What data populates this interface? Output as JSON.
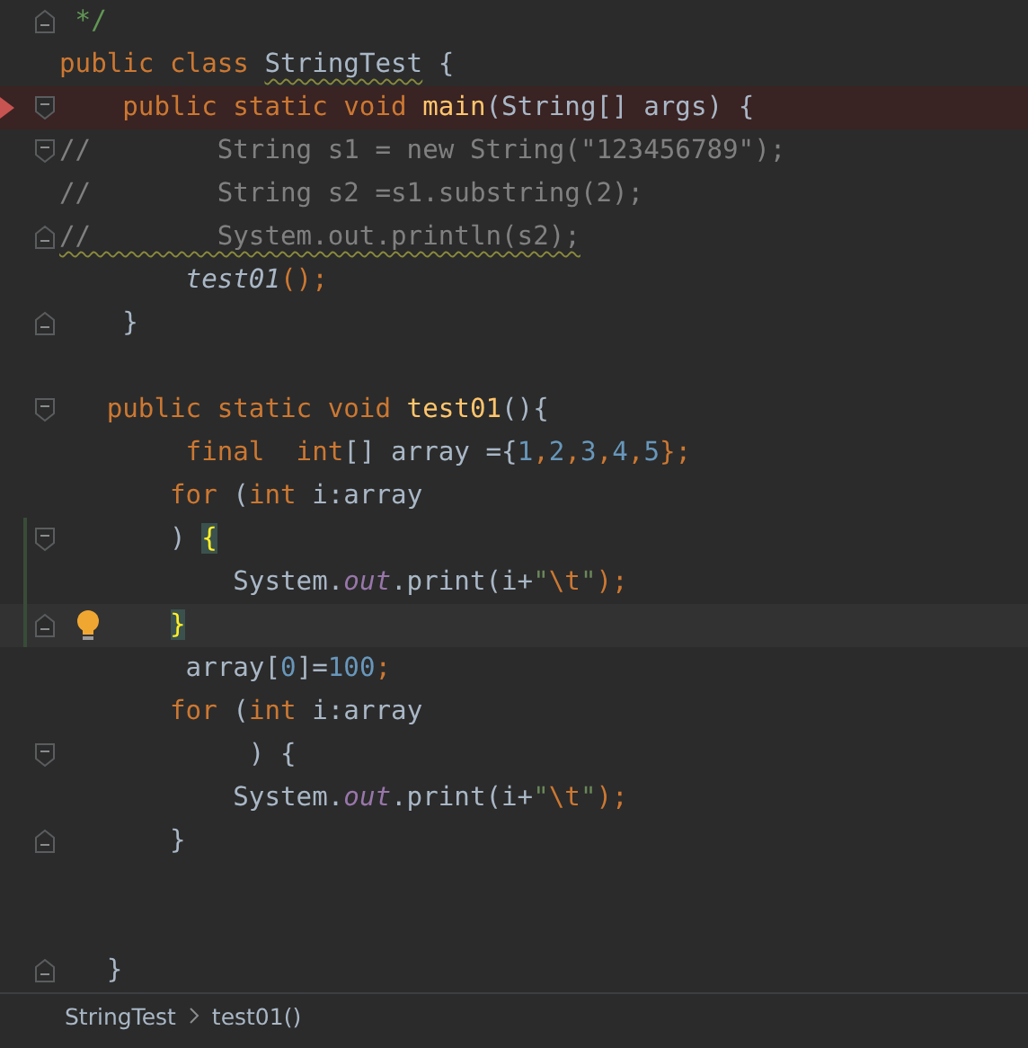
{
  "editor": {
    "lines": [
      {
        "fold_end": true,
        "tokens": [
          {
            "text": " */",
            "kind": "doc"
          }
        ]
      },
      {
        "tokens": [
          {
            "text": "public class ",
            "kind": "keyword"
          },
          {
            "text": "StringTest",
            "kind": "plain",
            "warning": true
          },
          {
            "text": " {",
            "kind": "plain"
          }
        ]
      },
      {
        "fold_start": true,
        "breakpoint": true,
        "tokens": [
          {
            "text": "    public static void ",
            "kind": "keyword"
          },
          {
            "text": "main",
            "kind": "method"
          },
          {
            "text": "(String[] args) {",
            "kind": "plain"
          }
        ]
      },
      {
        "fold_start": true,
        "tokens": [
          {
            "text": "//        String s1 = new String(\"123456789\");",
            "kind": "comment"
          }
        ]
      },
      {
        "tokens": [
          {
            "text": "//        String s2 =s1.substring(2);",
            "kind": "comment"
          }
        ]
      },
      {
        "fold_end": true,
        "tokens": [
          {
            "text": "//        System.out.println(s2);",
            "kind": "comment",
            "warning": true
          }
        ]
      },
      {
        "tokens": [
          {
            "text": "        test01",
            "kind": "static-call"
          },
          {
            "text": "();",
            "kind": "keyword"
          }
        ]
      },
      {
        "fold_end": true,
        "blank_after": true,
        "tokens": [
          {
            "text": "    }",
            "kind": "plain"
          }
        ]
      },
      {
        "fold_start": true,
        "tokens": [
          {
            "text": "   public static void ",
            "kind": "keyword"
          },
          {
            "text": "test01",
            "kind": "method"
          },
          {
            "text": "(){",
            "kind": "plain"
          }
        ]
      },
      {
        "tokens": [
          {
            "text": "        final  int",
            "kind": "keyword"
          },
          {
            "text": "[] array =",
            "kind": "plain"
          },
          {
            "text": "{",
            "kind": "plain"
          },
          {
            "text": "1",
            "kind": "number"
          },
          {
            "text": ",",
            "kind": "keyword"
          },
          {
            "text": "2",
            "kind": "number"
          },
          {
            "text": ",",
            "kind": "keyword"
          },
          {
            "text": "3",
            "kind": "number"
          },
          {
            "text": ",",
            "kind": "keyword"
          },
          {
            "text": "4",
            "kind": "number"
          },
          {
            "text": ",",
            "kind": "keyword"
          },
          {
            "text": "5",
            "kind": "number"
          },
          {
            "text": "};",
            "kind": "keyword"
          }
        ]
      },
      {
        "tokens": [
          {
            "text": "       for ",
            "kind": "keyword"
          },
          {
            "text": "(",
            "kind": "plain"
          },
          {
            "text": "int ",
            "kind": "keyword"
          },
          {
            "text": "i:array",
            "kind": "plain"
          }
        ]
      },
      {
        "fold_start": true,
        "changed": true,
        "tokens": [
          {
            "text": "       ) ",
            "kind": "plain"
          },
          {
            "text": "{",
            "kind": "brace-match"
          }
        ]
      },
      {
        "changed": true,
        "tokens": [
          {
            "text": "           System.",
            "kind": "plain"
          },
          {
            "text": "out",
            "kind": "static-field"
          },
          {
            "text": ".print(i+",
            "kind": "plain"
          },
          {
            "text": "\"",
            "kind": "string"
          },
          {
            "text": "\\t",
            "kind": "escape"
          },
          {
            "text": "\"",
            "kind": "string"
          },
          {
            "text": ");",
            "kind": "keyword"
          }
        ]
      },
      {
        "fold_end": true,
        "changed": true,
        "caret": true,
        "bulb": true,
        "tokens": [
          {
            "text": "       }",
            "kind": "brace-match"
          }
        ]
      },
      {
        "tokens": [
          {
            "text": "        array[",
            "kind": "plain"
          },
          {
            "text": "0",
            "kind": "number"
          },
          {
            "text": "]=",
            "kind": "plain"
          },
          {
            "text": "100",
            "kind": "number"
          },
          {
            "text": ";",
            "kind": "keyword"
          }
        ]
      },
      {
        "tokens": [
          {
            "text": "       for ",
            "kind": "keyword"
          },
          {
            "text": "(",
            "kind": "plain"
          },
          {
            "text": "int ",
            "kind": "keyword"
          },
          {
            "text": "i:array",
            "kind": "plain"
          }
        ]
      },
      {
        "fold_start": true,
        "tokens": [
          {
            "text": "            ) {",
            "kind": "plain"
          }
        ]
      },
      {
        "tokens": [
          {
            "text": "           System.",
            "kind": "plain"
          },
          {
            "text": "out",
            "kind": "static-field"
          },
          {
            "text": ".print(i+",
            "kind": "plain"
          },
          {
            "text": "\"",
            "kind": "string"
          },
          {
            "text": "\\t",
            "kind": "escape"
          },
          {
            "text": "\"",
            "kind": "string"
          },
          {
            "text": ");",
            "kind": "keyword"
          }
        ]
      },
      {
        "fold_end": true,
        "blank_after": true,
        "tokens": [
          {
            "text": "       }",
            "kind": "plain"
          }
        ]
      },
      {
        "fold_end": true,
        "blank_before": true,
        "tokens": [
          {
            "text": "   }",
            "kind": "plain"
          }
        ]
      }
    ]
  },
  "breadcrumbs": [
    "StringTest",
    "test01()"
  ]
}
